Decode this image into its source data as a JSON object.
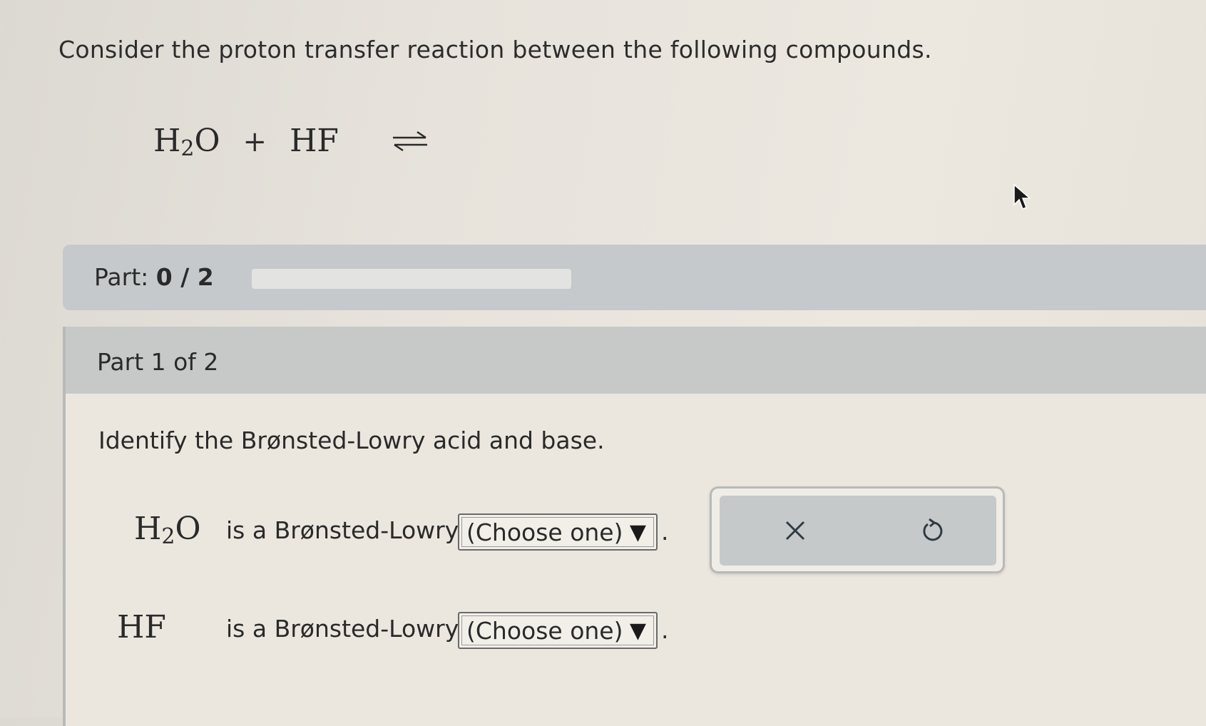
{
  "question": {
    "text": "Consider the proton transfer reaction between the following compounds."
  },
  "reaction": {
    "reactant1": {
      "base": "H",
      "sub": "2",
      "tail": "O"
    },
    "plus": "+",
    "reactant2": "HF",
    "arrow_icon": "equilibrium-arrows-icon"
  },
  "progress": {
    "label": "Part:",
    "value": "0 / 2",
    "completed_fraction": 0
  },
  "part": {
    "title": "Part 1 of 2",
    "instruction": "Identify the Brønsted-Lowry acid and base."
  },
  "rows": [
    {
      "compound": {
        "base": "H",
        "sub": "2",
        "tail": "O"
      },
      "text": "is a Brønsted-Lowry",
      "select": "(Choose one)",
      "period": "."
    },
    {
      "compound": {
        "base": "HF",
        "sub": "",
        "tail": ""
      },
      "text": "is a Brønsted-Lowry",
      "select": "(Choose one)",
      "period": "."
    }
  ],
  "actions": {
    "clear_icon": "close-icon",
    "reset_icon": "undo-icon"
  },
  "select_arrow": "▼",
  "colors": {
    "progress_bar_bg": "#c6c9cb",
    "part_header_bg": "#c7c9c9",
    "panel_bg": "#ebe7df"
  }
}
